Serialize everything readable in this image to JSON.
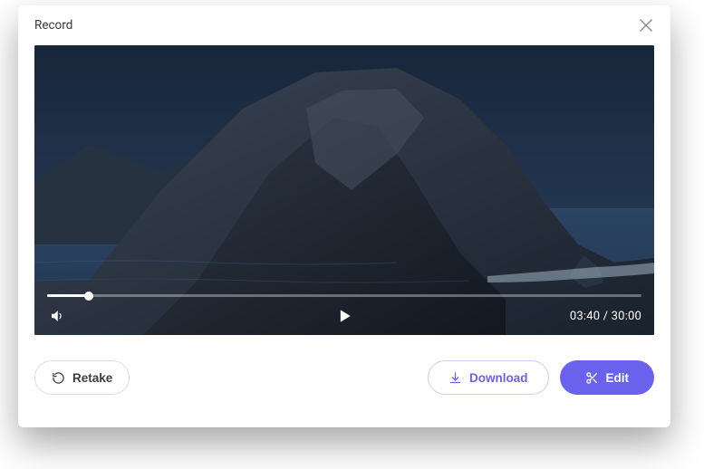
{
  "header": {
    "title": "Record"
  },
  "player": {
    "progress_percent": 7,
    "current_time": "03:40",
    "total_time": "30:00",
    "time_separator": " / "
  },
  "actions": {
    "retake_label": "Retake",
    "download_label": "Download",
    "edit_label": "Edit"
  },
  "colors": {
    "accent": "#6a62ec"
  }
}
